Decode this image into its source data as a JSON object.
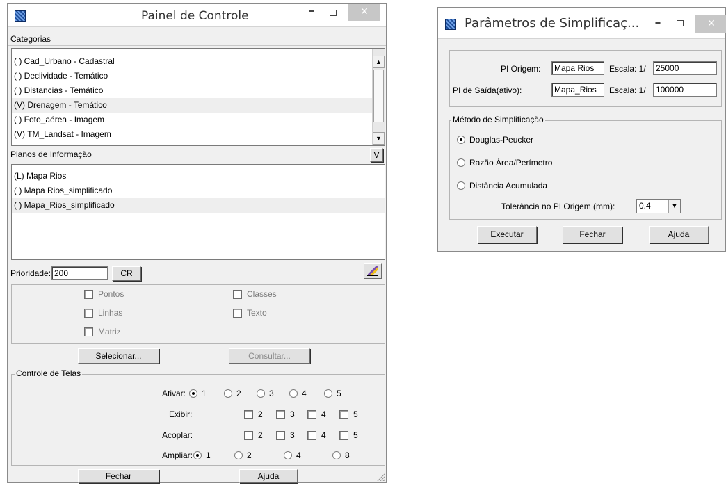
{
  "painel": {
    "title": "Painel de Controle",
    "categorias_label": "Categorias",
    "categorias": [
      {
        "label": "( ) Cad_Urbano - Cadastral",
        "selected": false
      },
      {
        "label": "( ) Declividade - Temático",
        "selected": false
      },
      {
        "label": "( ) Distancias - Temático",
        "selected": false
      },
      {
        "label": "(V) Drenagem - Temático",
        "selected": true
      },
      {
        "label": "( ) Foto_aérea - Imagem",
        "selected": false
      },
      {
        "label": "(V) TM_Landsat - Imagem",
        "selected": false
      }
    ],
    "planos_label": "Planos de Informação",
    "planos_toggle": "V",
    "planos": [
      {
        "label": "(L) Mapa Rios",
        "selected": false
      },
      {
        "label": "( ) Mapa Rios_simplificado",
        "selected": false
      },
      {
        "label": "( ) Mapa_Rios_simplificado",
        "selected": true
      }
    ],
    "prioridade_label": "Prioridade:",
    "prioridade_value": "200",
    "cr_label": "CR",
    "checks": {
      "pontos": "Pontos",
      "linhas": "Linhas",
      "matriz": "Matriz",
      "classes": "Classes",
      "texto": "Texto"
    },
    "selecionar_label": "Selecionar...",
    "consultar_label": "Consultar...",
    "controle_label": "Controle de Telas",
    "ativar_label": "Ativar:",
    "exibir_label": "Exibir:",
    "acoplar_label": "Acoplar:",
    "ampliar_label": "Ampliar:",
    "n1": "1",
    "n2": "2",
    "n3": "3",
    "n4": "4",
    "n5": "5",
    "n8": "8",
    "fechar_label": "Fechar",
    "ajuda_label": "Ajuda"
  },
  "params": {
    "title": "Parâmetros de Simplificaç...",
    "pi_origem_label": "PI Origem:",
    "pi_origem_value": "Mapa Rios",
    "escala_label": "Escala: 1/",
    "escala_origem": "25000",
    "pi_saida_label": "PI de Saída(ativo):",
    "pi_saida_value": "Mapa_Rios",
    "escala_saida": "100000",
    "metodo_label": "Método de Simplificação",
    "metodos": [
      "Douglas-Peucker",
      "Razão Área/Perímetro",
      "Distância Acumulada"
    ],
    "tolerancia_label": "Tolerância no PI Origem (mm):",
    "tolerancia_value": "0.4",
    "executar_label": "Executar",
    "fechar_label": "Fechar",
    "ajuda_label": "Ajuda"
  },
  "window_buttons": {
    "minimize": "–",
    "close": "✕"
  }
}
